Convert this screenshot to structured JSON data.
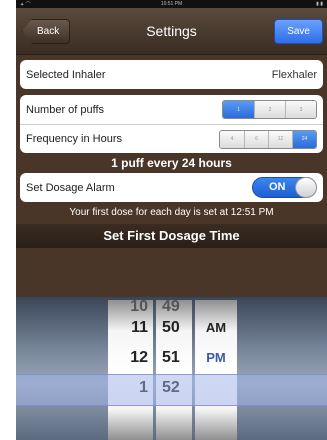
{
  "status_bar": {
    "left": "✦ ⌒",
    "time": "10:51 PM",
    "right": "▮ ▮"
  },
  "navbar": {
    "title": "Settings",
    "back_label": "Back",
    "save_label": "Save"
  },
  "inhaler": {
    "label": "Selected Inhaler",
    "value": "Flexhaler"
  },
  "puffs": {
    "label": "Number of puffs",
    "options": [
      "1",
      "2",
      "3"
    ],
    "selected": "1"
  },
  "frequency": {
    "label": "Frequency in Hours",
    "options": [
      "4",
      "6",
      "12",
      "24"
    ],
    "selected": "24"
  },
  "summary": "1 puff every 24 hours",
  "alarm": {
    "label": "Set Dosage Alarm",
    "toggle_label": "ON",
    "enabled": true
  },
  "first_dose_info": "Your first dose for each day is set at 12:51 PM",
  "picker_header": "Set First Dosage Time",
  "picker": {
    "hours": [
      "10",
      "11",
      "12",
      "1"
    ],
    "minutes": [
      "49",
      "50",
      "51",
      "52"
    ],
    "ampm": [
      "AM",
      "PM"
    ],
    "selected": {
      "hour": "12",
      "minute": "51",
      "ampm": "PM"
    }
  },
  "colors": {
    "accent": "#2e6ee6",
    "background": "#4a3628",
    "segment_selected": "#2a6bd8"
  }
}
